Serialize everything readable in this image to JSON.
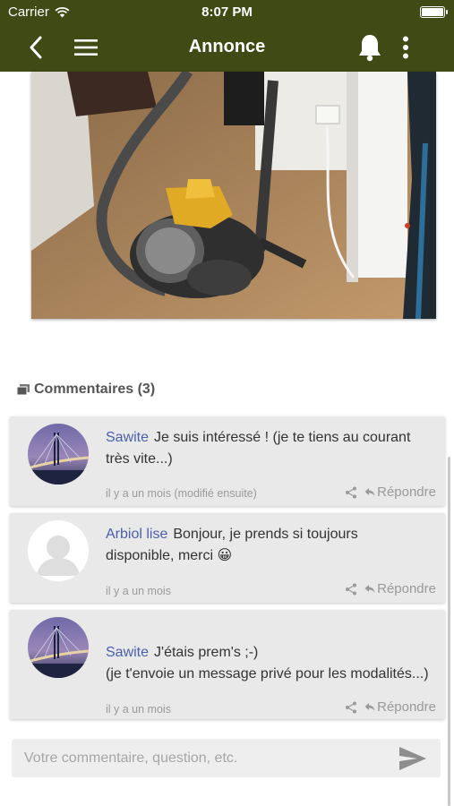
{
  "status_bar": {
    "carrier": "Carrier",
    "time": "8:07 PM"
  },
  "nav": {
    "title": "Annonce"
  },
  "photo": {
    "alt": "vacuum-cleaner-photo"
  },
  "comments": {
    "header": "Commentaires (3)",
    "items": [
      {
        "author": "Sawite",
        "text": "Je suis intéressé ! (je te tiens au courant très vite...)",
        "meta": "il y a un mois (modifié ensuite)",
        "reply_label": "Répondre",
        "avatar": "bridge-photo"
      },
      {
        "author": "Arbiol lise",
        "text": "Bonjour, je prends si toujours disponible, merci 😀",
        "meta": "il y a un mois",
        "reply_label": "Répondre",
        "avatar": "default-user"
      },
      {
        "author": "Sawite",
        "text": "J'étais prem's ;-)\n(je t'envoie un message privé pour les modalités...)",
        "meta": "il y a un mois",
        "reply_label": "Répondre",
        "avatar": "bridge-photo"
      }
    ]
  },
  "comment_input": {
    "placeholder": "Votre commentaire, question, etc.",
    "value": ""
  },
  "colors": {
    "nav_bg": "#3f4a14",
    "author": "#4a5fae",
    "card_bg": "#e9e9e9"
  }
}
